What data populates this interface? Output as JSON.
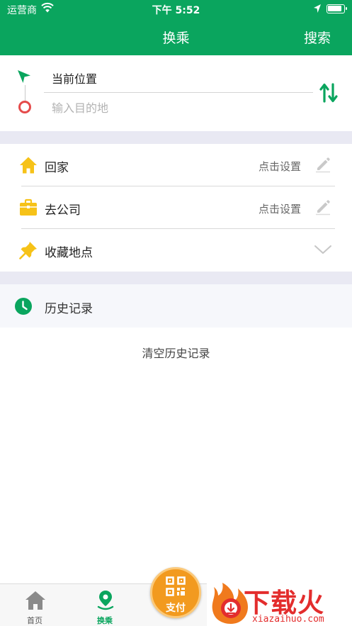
{
  "status_bar": {
    "carrier": "运营商",
    "time": "下午 5:52"
  },
  "nav": {
    "title": "换乘",
    "search_label": "搜索"
  },
  "route": {
    "start_text": "当前位置",
    "destination_placeholder": "输入目的地",
    "destination_value": ""
  },
  "places": [
    {
      "label": "回家",
      "value": "点击设置",
      "icon": "home-icon"
    },
    {
      "label": "去公司",
      "value": "点击设置",
      "icon": "briefcase-icon"
    },
    {
      "label": "收藏地点",
      "value": "",
      "icon": "pin-icon"
    }
  ],
  "history": {
    "title": "历史记录",
    "clear_label": "清空历史记录"
  },
  "tabbar": {
    "tabs": [
      {
        "label": "首页",
        "icon": "home-tab-icon",
        "active": false
      },
      {
        "label": "换乘",
        "icon": "transfer-tab-icon",
        "active": true
      }
    ],
    "pay_label": "支付"
  },
  "watermark": {
    "cn": "下载火",
    "en": "xiazaihuo.com"
  },
  "colors": {
    "brand_green": "#0aa55e",
    "accent_orange": "#f29a1f",
    "watermark_red": "#e32d2d",
    "destination_red": "#e54b4b",
    "place_icon_yellow": "#f6c218"
  }
}
